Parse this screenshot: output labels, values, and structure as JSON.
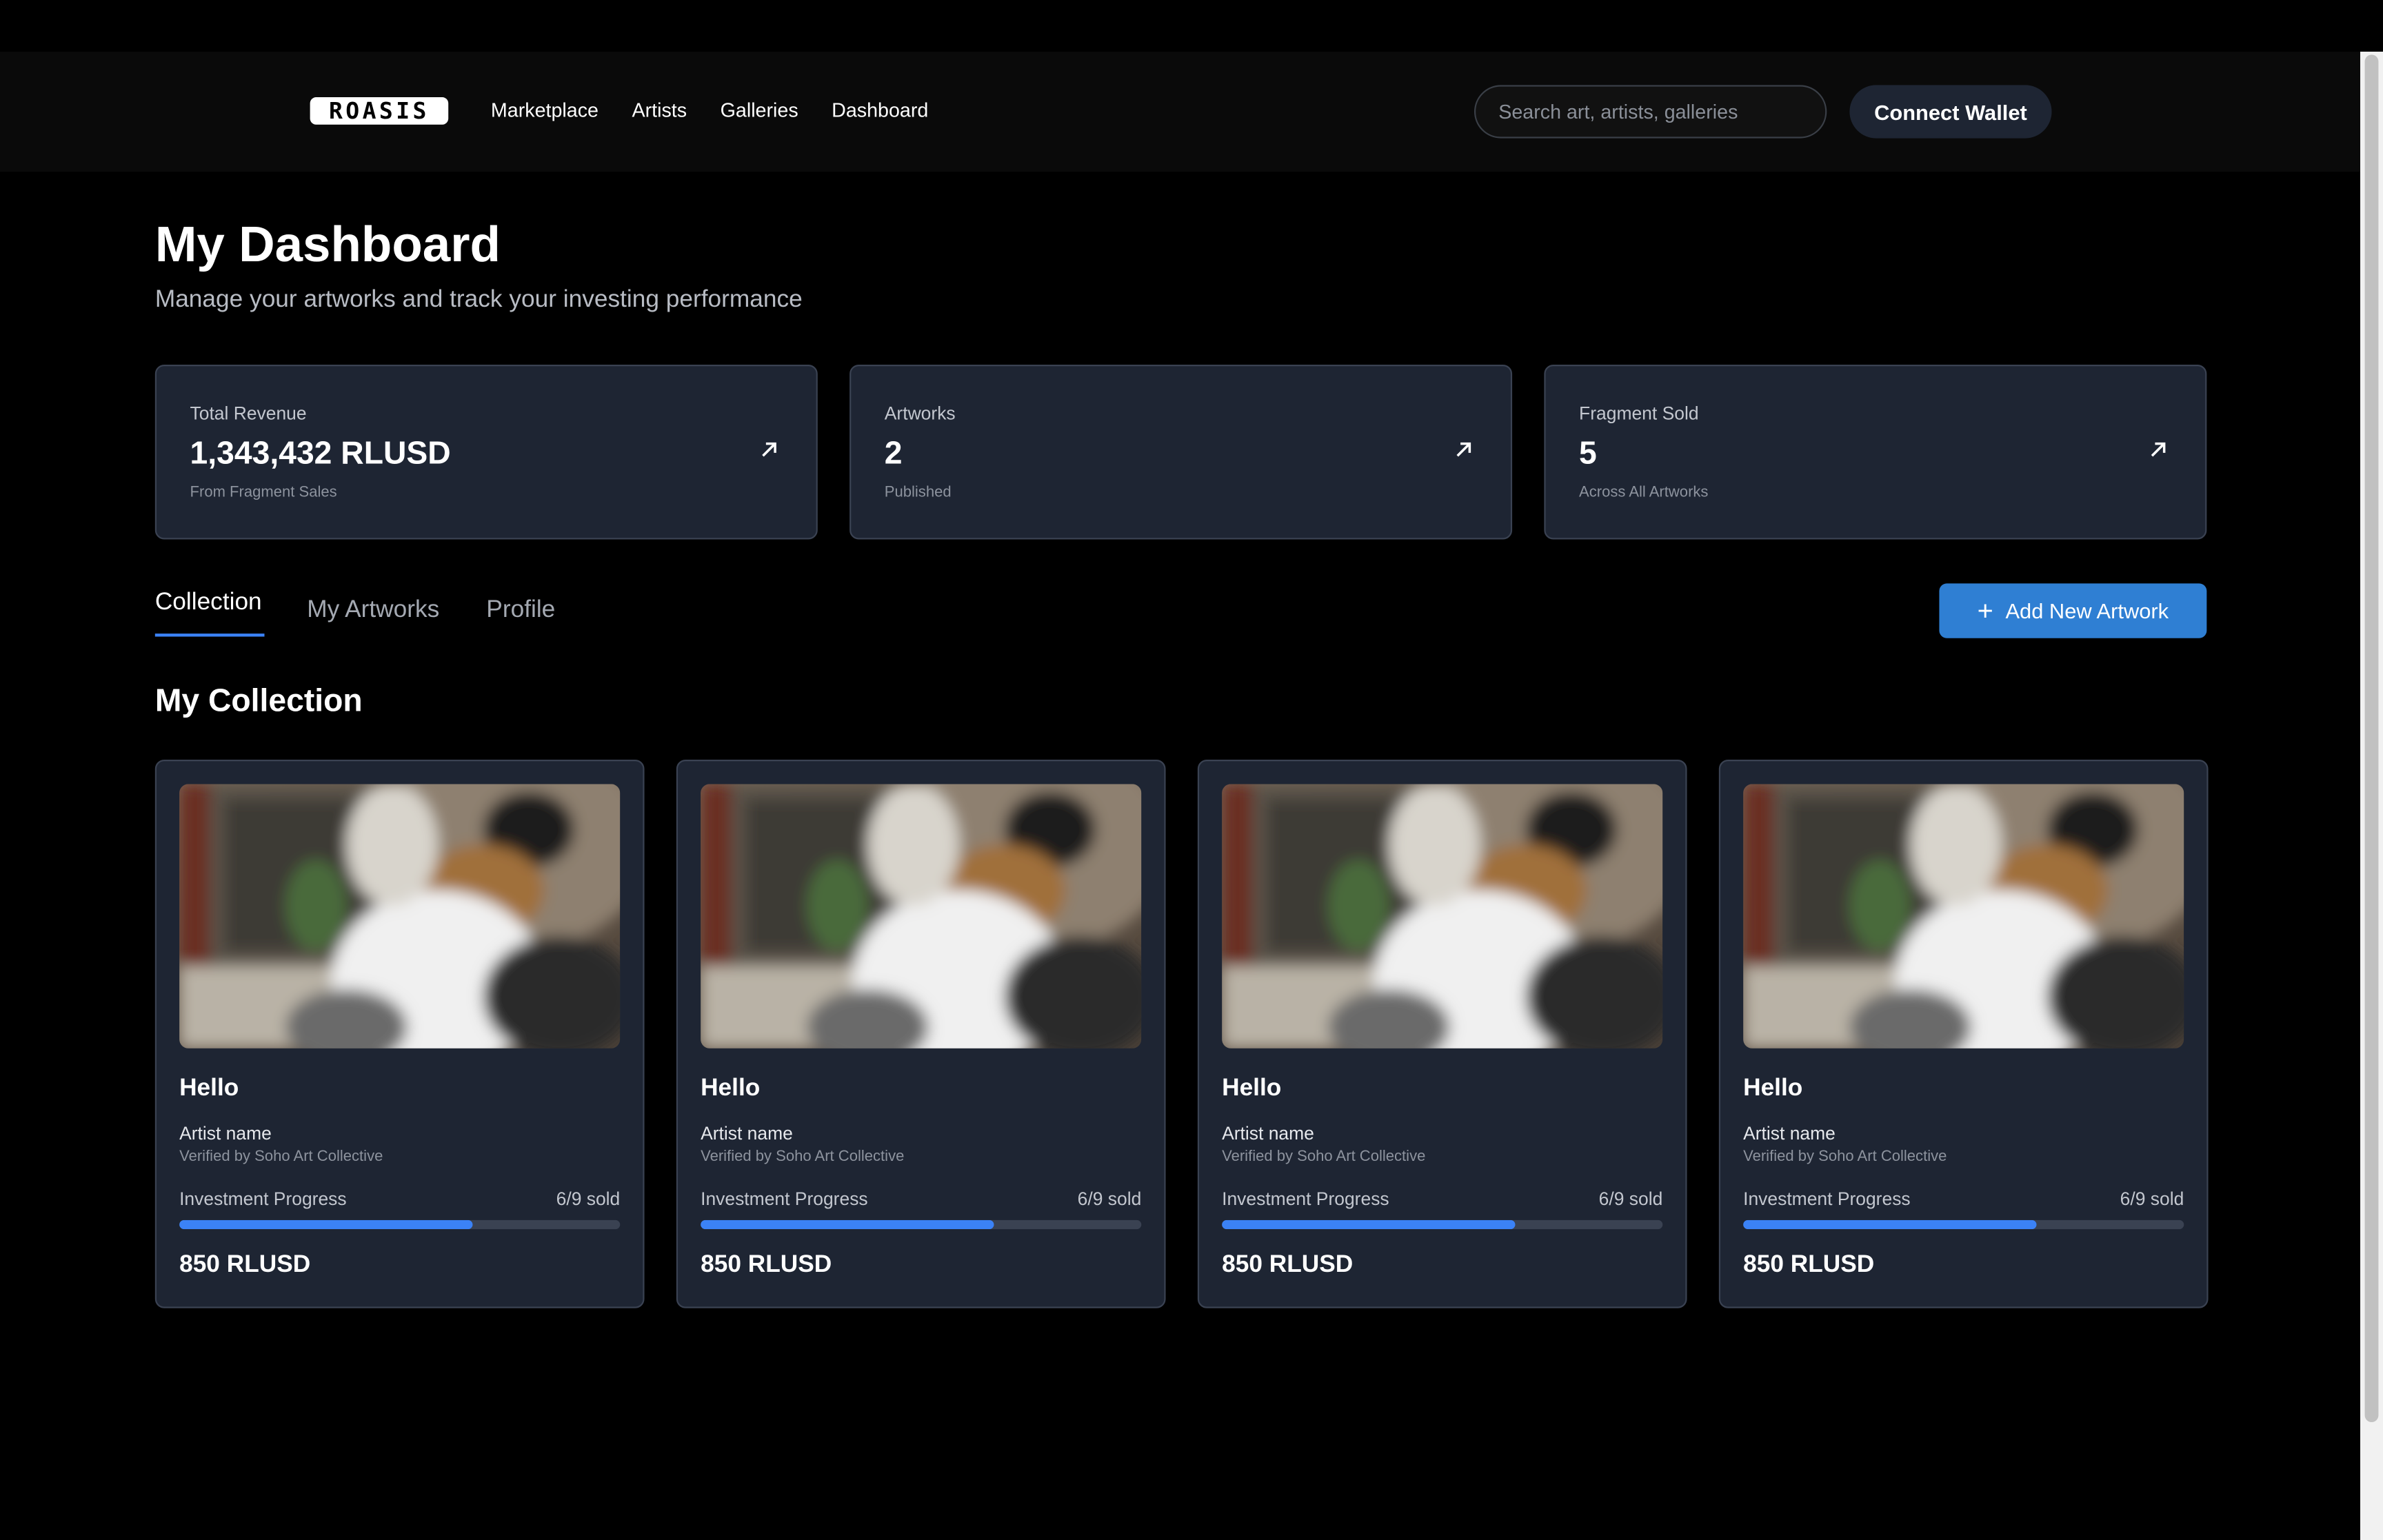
{
  "header": {
    "logo_text": "ROASIS",
    "nav": [
      "Marketplace",
      "Artists",
      "Galleries",
      "Dashboard"
    ],
    "search_placeholder": "Search art, artists, galleries",
    "connect_wallet": "Connect Wallet"
  },
  "page": {
    "title": "My Dashboard",
    "subtitle": "Manage your artworks and track your investing performance"
  },
  "stats": [
    {
      "label": "Total Revenue",
      "value": "1,343,432 RLUSD",
      "sub": "From Fragment Sales",
      "icon": "arrow-up-right-icon"
    },
    {
      "label": "Artworks",
      "value": "2",
      "sub": "Published",
      "icon": "arrow-up-right-icon"
    },
    {
      "label": "Fragment Sold",
      "value": "5",
      "sub": "Across All Artworks",
      "icon": "arrow-up-right-icon"
    }
  ],
  "tabs": [
    "Collection",
    "My Artworks",
    "Profile"
  ],
  "active_tab": "Collection",
  "add_button": "Add New Artwork",
  "section_title": "My Collection",
  "cards": [
    {
      "name": "Hello",
      "artist": "Artist name",
      "verified": "Verified by Soho Art Collective",
      "progress_label": "Investment Progress",
      "sold": "6/9 sold",
      "progress": 0.6667,
      "price": "850 RLUSD"
    },
    {
      "name": "Hello",
      "artist": "Artist name",
      "verified": "Verified by Soho Art Collective",
      "progress_label": "Investment Progress",
      "sold": "6/9 sold",
      "progress": 0.6667,
      "price": "850 RLUSD"
    },
    {
      "name": "Hello",
      "artist": "Artist name",
      "verified": "Verified by Soho Art Collective",
      "progress_label": "Investment Progress",
      "sold": "6/9 sold",
      "progress": 0.6667,
      "price": "850 RLUSD"
    },
    {
      "name": "Hello",
      "artist": "Artist name",
      "verified": "Verified by Soho Art Collective",
      "progress_label": "Investment Progress",
      "sold": "6/9 sold",
      "progress": 0.6667,
      "price": "850 RLUSD"
    }
  ],
  "colors": {
    "accent": "#3b82f6",
    "card_bg": "#1e2533",
    "button": "#2f7fd3"
  }
}
